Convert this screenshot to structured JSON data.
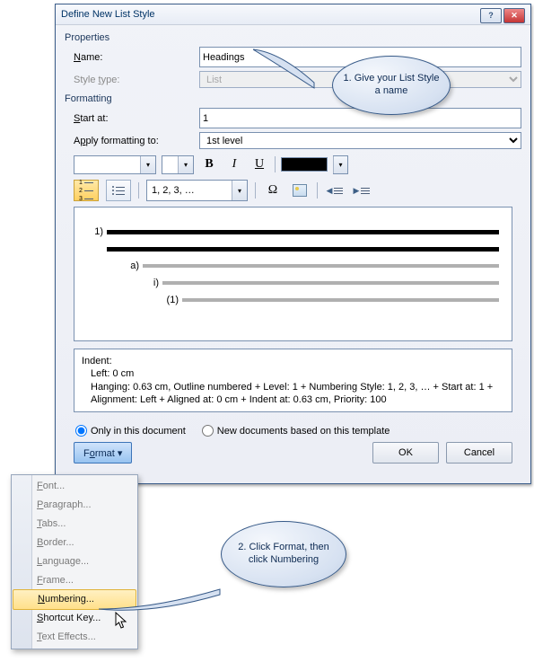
{
  "dialog": {
    "title": "Define New List Style",
    "properties_header": "Properties",
    "name_label": "Name:",
    "name_value": "Headings",
    "styletype_label": "Style type:",
    "styletype_value": "List",
    "formatting_header": "Formatting",
    "startat_label": "Start at:",
    "startat_value": "1",
    "apply_label": "Apply formatting to:",
    "apply_value": "1st level",
    "numfmt_value": "1, 2, 3, …",
    "radio_only": "Only in this document",
    "radio_newdocs": "New documents based on this template",
    "format_button": "Format ▾",
    "ok": "OK",
    "cancel": "Cancel"
  },
  "preview": {
    "levels": [
      {
        "num": "1)",
        "indent": 0,
        "bold": true
      },
      {
        "num": "",
        "indent": 0,
        "bold": true
      },
      {
        "num": "a)",
        "indent": 40,
        "bold": false
      },
      {
        "num": "i)",
        "indent": 62,
        "bold": false
      },
      {
        "num": "(1)",
        "indent": 84,
        "bold": false
      }
    ]
  },
  "description": {
    "line1": "Indent:",
    "line2": "Left:  0 cm",
    "line3": "Hanging:  0.63 cm, Outline numbered + Level: 1 + Numbering Style: 1, 2, 3, … + Start at: 1 + Alignment: Left + Aligned at:  0 cm + Indent at:  0.63 cm, Priority: 100"
  },
  "menu": {
    "items": [
      {
        "label": "Font...",
        "enabled": false
      },
      {
        "label": "Paragraph...",
        "enabled": false
      },
      {
        "label": "Tabs...",
        "enabled": false
      },
      {
        "label": "Border...",
        "enabled": false
      },
      {
        "label": "Language...",
        "enabled": false
      },
      {
        "label": "Frame...",
        "enabled": false
      },
      {
        "label": "Numbering...",
        "enabled": true,
        "hover": true
      },
      {
        "label": "Shortcut Key...",
        "enabled": true
      },
      {
        "label": "Text Effects...",
        "enabled": false
      }
    ]
  },
  "callouts": {
    "c1": "1. Give your List Style a name",
    "c2": "2. Click Format, then click Numbering"
  }
}
